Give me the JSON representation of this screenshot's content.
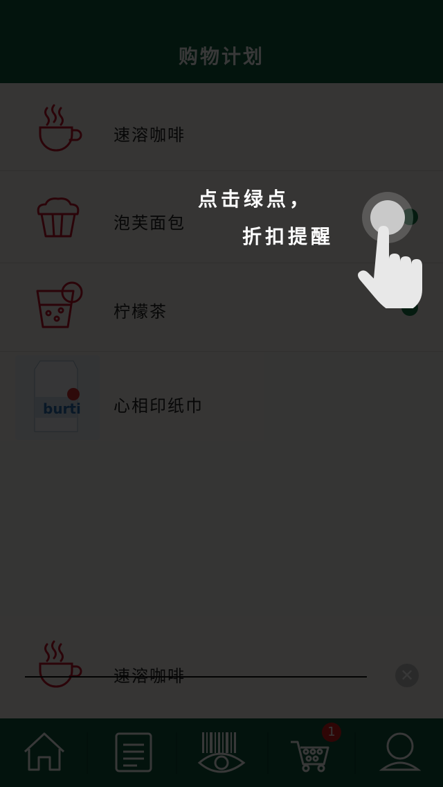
{
  "header": {
    "title": "购物计划"
  },
  "list": {
    "items": [
      {
        "name": "速溶咖啡",
        "icon": "coffee-cup-icon"
      },
      {
        "name": "泡芙面包",
        "icon": "muffin-icon"
      },
      {
        "name": "柠檬茶",
        "icon": "lemon-tea-icon"
      },
      {
        "name": "心相印纸巾",
        "icon": "product-thumbnail",
        "thumb_brand": "burti"
      }
    ]
  },
  "completed": {
    "items": [
      {
        "name": "速溶咖啡",
        "icon": "coffee-cup-icon",
        "close_icon": "close-icon"
      }
    ]
  },
  "tabbar": {
    "tabs": [
      {
        "icon": "home-icon"
      },
      {
        "icon": "list-document-icon"
      },
      {
        "icon": "barcode-eye-icon"
      },
      {
        "icon": "cart-icon",
        "badge": "1"
      },
      {
        "icon": "user-icon"
      }
    ]
  },
  "tutorial": {
    "line1": "点击绿点，",
    "line2": "折扣提醒",
    "hand_icon": "tap-hand-icon"
  },
  "colors": {
    "brand_green": "#0f5a3e",
    "dot_green": "#1a7a4a",
    "icon_red": "#c2152b",
    "badge_red": "#d51f1f"
  }
}
